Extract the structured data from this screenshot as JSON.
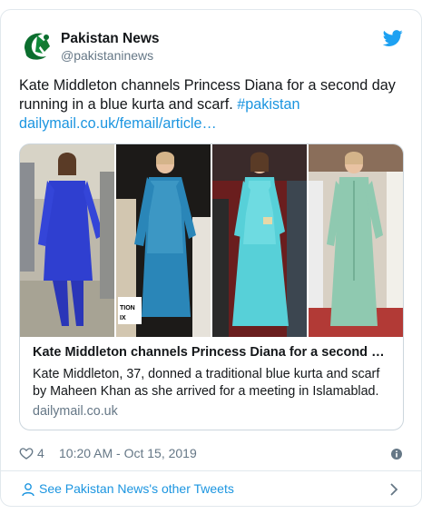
{
  "author": {
    "display_name": "Pakistan News",
    "handle": "@pakistaninews"
  },
  "tweet": {
    "text": "Kate Middleton channels Princess Diana for a second day running in a blue kurta and scarf.",
    "hashtag": "#pakistan",
    "link": "dailymail.co.uk/femail/article…"
  },
  "card": {
    "title": "Kate Middleton channels Princess Diana for a second da…",
    "description": "Kate Middleton, 37, donned a traditional blue kurta and scarf by Maheen Khan as she arrived for a meeting in Islamablad.",
    "domain": "dailymail.co.uk",
    "image_overlay_text": "TION\nIX"
  },
  "meta": {
    "likes": "4",
    "timestamp": "10:20 AM - Oct 15, 2019"
  },
  "footer": {
    "label": "See Pakistan News's other Tweets"
  },
  "icons": {
    "heart": "heart-icon",
    "info": "info-icon",
    "twitter": "twitter-bird-icon",
    "person": "person-icon",
    "chevron": "chevron-right-icon"
  },
  "colors": {
    "link": "#1b95e0",
    "muted": "#657786",
    "border": "#e1e8ed"
  }
}
